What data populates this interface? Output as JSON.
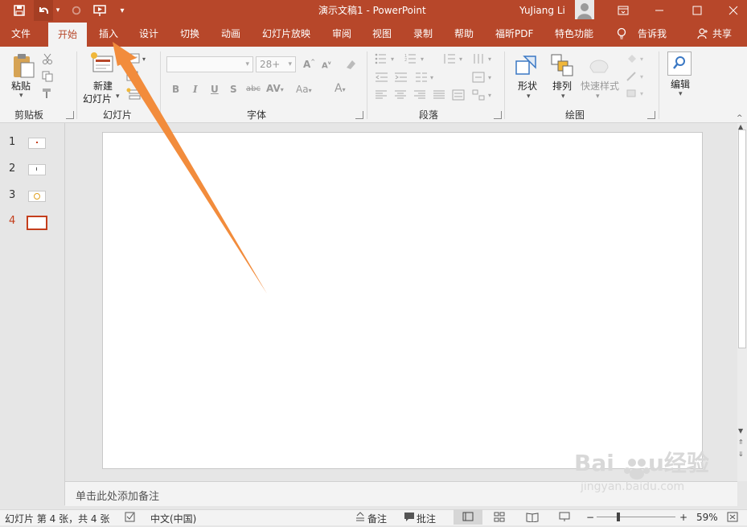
{
  "titlebar": {
    "title": "演示文稿1  -  PowerPoint",
    "user_name": "YuJiang Li",
    "colors": {
      "accent": "#b7472a",
      "text": "#ffffff"
    }
  },
  "tabs": [
    "文件",
    "开始",
    "插入",
    "设计",
    "切换",
    "动画",
    "幻灯片放映",
    "审阅",
    "视图",
    "录制",
    "帮助",
    "福昕PDF",
    "特色功能"
  ],
  "active_tab": "开始",
  "tell_me": "告诉我",
  "share": "共享",
  "ribbon": {
    "clipboard": {
      "paste": "粘贴",
      "group": "剪贴板"
    },
    "slides": {
      "new_slide_line1": "新建",
      "new_slide_line2": "幻灯片",
      "group": "幻灯片"
    },
    "font": {
      "font_size": "28+",
      "group": "字体"
    },
    "paragraph": {
      "group": "段落"
    },
    "drawing": {
      "shapes": "形状",
      "arrange": "排列",
      "quick_styles": "快速样式",
      "group": "绘图"
    },
    "editing": {
      "label": "编辑"
    }
  },
  "thumbnails": [
    {
      "number": "1"
    },
    {
      "number": "2"
    },
    {
      "number": "3"
    },
    {
      "number": "4",
      "active": true
    }
  ],
  "notes_placeholder": "单击此处添加备注",
  "status": {
    "slide_info": "幻灯片 第 4 张，共 4 张",
    "language": "中文(中国)",
    "notes": "备注",
    "comments": "批注",
    "zoom": "59%"
  },
  "watermark": {
    "text": "Baidu经验",
    "url_text": "jingyan.baidu.com"
  },
  "annotation_arrow_color": "#f28c3c"
}
